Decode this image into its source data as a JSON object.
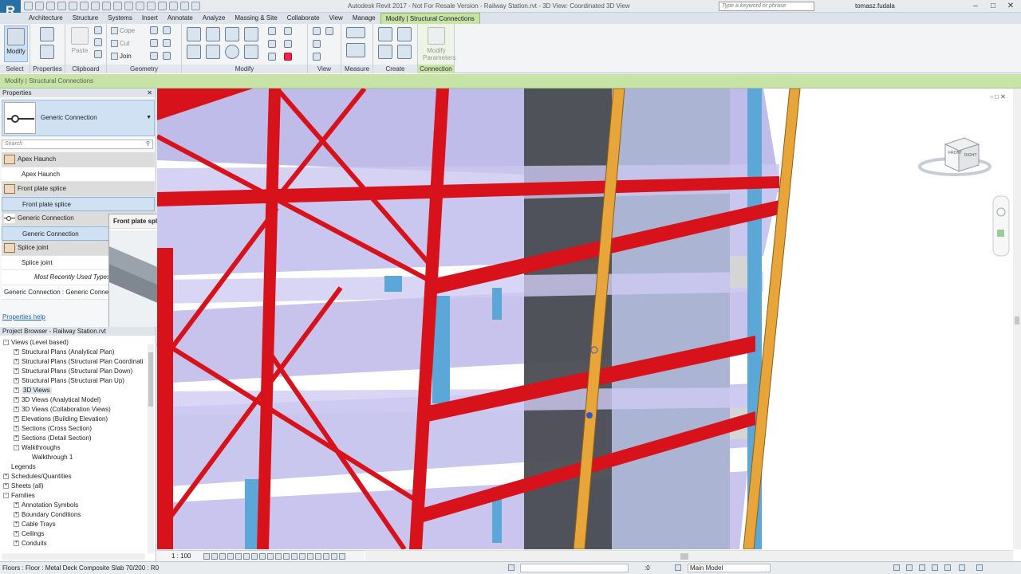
{
  "window": {
    "title": "Autodesk Revit 2017 - Not For Resale Version -    Railway Station.rvt - 3D View: Coordinated 3D View",
    "search_placeholder": "Type a keyword or phrase",
    "user": "tomasz.fudala",
    "app_letter": "R"
  },
  "tabs": [
    "Architecture",
    "Structure",
    "Systems",
    "Insert",
    "Annotate",
    "Analyze",
    "Massing & Site",
    "Collaborate",
    "View",
    "Manage",
    "Modify | Structural Connections"
  ],
  "ribbon": {
    "modify_label": "Modify",
    "paste_label": "Paste",
    "cope_label": "Cope",
    "cut_label": "Cut",
    "join_label": "Join",
    "modify_parameters_label": "Modify Parameters",
    "panels": {
      "select": "Select",
      "properties": "Properties",
      "clipboard": "Clipboard",
      "geometry": "Geometry",
      "modify": "Modify",
      "view": "View",
      "measure": "Measure",
      "create": "Create",
      "connection": "Connection"
    }
  },
  "context_bar": "Modify | Structural Connections",
  "properties": {
    "title": "Properties",
    "type_name": "Generic Connection",
    "search_placeholder": "Search",
    "items": [
      {
        "label": "Apex Haunch"
      },
      {
        "label": "Apex Haunch"
      },
      {
        "label": "Front plate splice"
      },
      {
        "label": "Front plate splice"
      },
      {
        "label": "Generic Connection"
      },
      {
        "label": "Generic Connection"
      },
      {
        "label": "Splice joint"
      },
      {
        "label": "Splice joint"
      },
      {
        "label": "Most Recently Used Types"
      },
      {
        "label": "Generic Connection : Generic Connection"
      }
    ],
    "help": "Properties help"
  },
  "tooltip": {
    "title": "Front plate splice"
  },
  "browser": {
    "title": "Project Browser - Railway Station.rvt",
    "nodes": [
      {
        "label": "Views (Level based)",
        "depth": 0,
        "toggle": "-"
      },
      {
        "label": "Structural Plans (Analytical Plan)",
        "depth": 1,
        "toggle": "+"
      },
      {
        "label": "Structural Plans (Structural Plan Coordinati",
        "depth": 1,
        "toggle": "+"
      },
      {
        "label": "Structural Plans (Structural Plan Down)",
        "depth": 1,
        "toggle": "+"
      },
      {
        "label": "Structural Plans (Structural Plan Up)",
        "depth": 1,
        "toggle": "+"
      },
      {
        "label": "3D Views",
        "depth": 1,
        "toggle": "+",
        "highlight": true
      },
      {
        "label": "3D Views (Analytical Model)",
        "depth": 1,
        "toggle": "+"
      },
      {
        "label": "3D Views (Collaboration Views)",
        "depth": 1,
        "toggle": "+"
      },
      {
        "label": "Elevations (Building Elevation)",
        "depth": 1,
        "toggle": "+"
      },
      {
        "label": "Sections (Cross Section)",
        "depth": 1,
        "toggle": "+"
      },
      {
        "label": "Sections (Detail Section)",
        "depth": 1,
        "toggle": "+"
      },
      {
        "label": "Walkthroughs",
        "depth": 1,
        "toggle": "-"
      },
      {
        "label": "Walkthrough 1",
        "depth": 2,
        "toggle": ""
      },
      {
        "label": "Legends",
        "depth": 0,
        "toggle": ""
      },
      {
        "label": "Schedules/Quantities",
        "depth": 0,
        "toggle": "+"
      },
      {
        "label": "Sheets (all)",
        "depth": 0,
        "toggle": "+"
      },
      {
        "label": "Families",
        "depth": 0,
        "toggle": "-"
      },
      {
        "label": "Annotation Symbols",
        "depth": 1,
        "toggle": "+"
      },
      {
        "label": "Boundary Conditions",
        "depth": 1,
        "toggle": "+"
      },
      {
        "label": "Cable Trays",
        "depth": 1,
        "toggle": "+"
      },
      {
        "label": "Ceilings",
        "depth": 1,
        "toggle": "+"
      },
      {
        "label": "Conduits",
        "depth": 1,
        "toggle": "+"
      }
    ]
  },
  "view": {
    "scale": "1 : 100",
    "cube_front": "FRONT",
    "cube_right": "RIGHT"
  },
  "status": {
    "text": "Floors : Floor : Metal Deck Composite Slab 70/200 : R0",
    "zero": ":0",
    "model": "Main Model"
  },
  "colors": {
    "steel_red": "#d8121b",
    "steel_orange": "#e8a53a",
    "column_blue": "#5aa7d8",
    "slab": "#b7b3e6",
    "context_green": "#c7e3a6"
  }
}
